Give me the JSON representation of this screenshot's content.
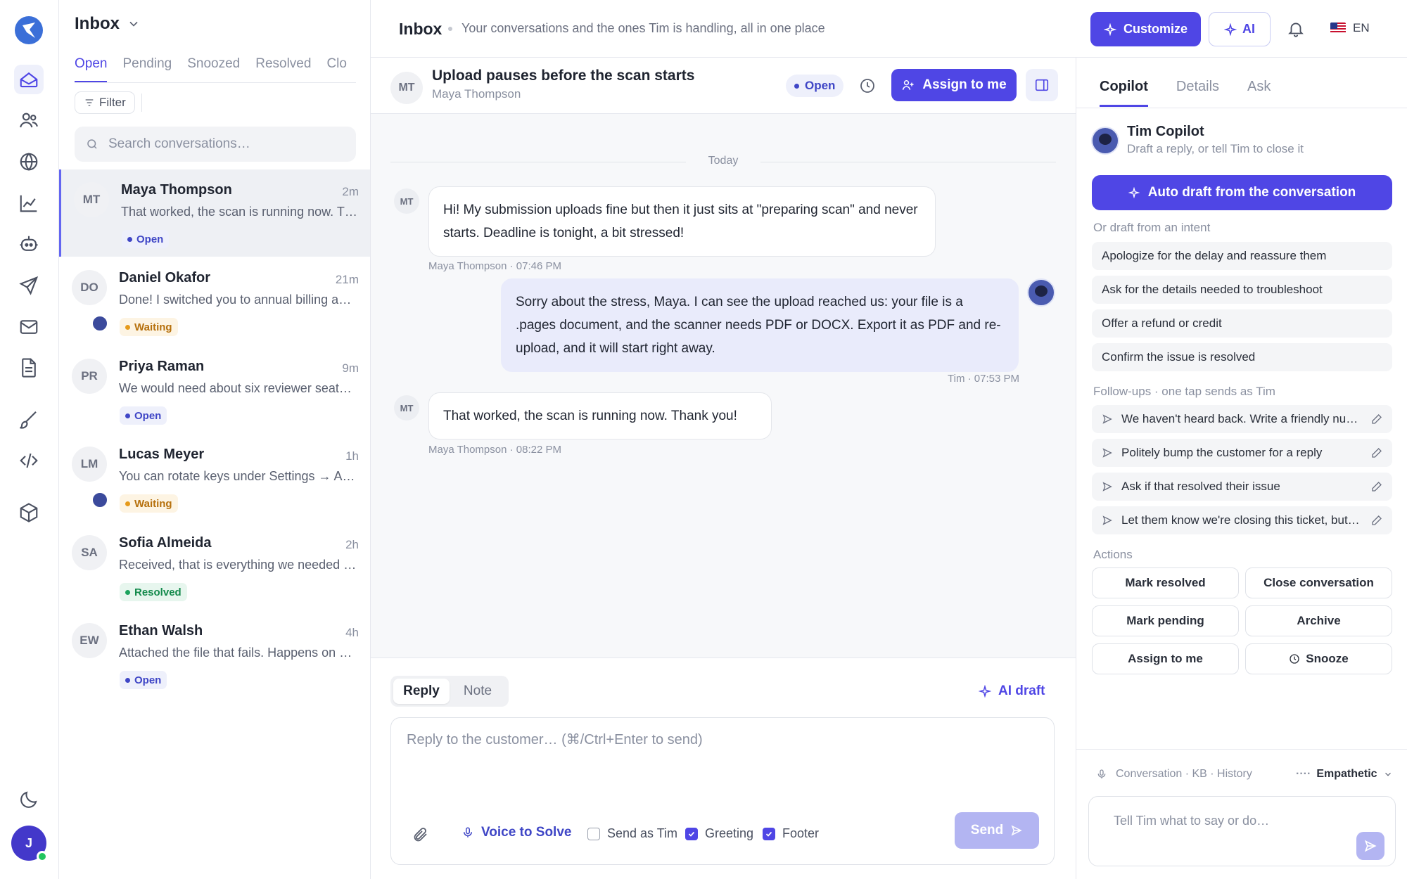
{
  "rail": {
    "items": [
      "inbox-icon",
      "contacts-icon",
      "globe-icon",
      "analytics-icon",
      "bot-icon",
      "send-icon",
      "mail-icon",
      "document-icon",
      "brush-icon",
      "code-icon",
      "box-icon"
    ],
    "user_initial": "J"
  },
  "list": {
    "title": "Inbox",
    "tabs": [
      "Open",
      "Pending",
      "Snoozed",
      "Resolved",
      "Clo"
    ],
    "filter_label": "Filter",
    "search_placeholder": "Search conversations…",
    "conversations": [
      {
        "initials": "MT",
        "name": "Maya Thompson",
        "time": "2m",
        "preview": "That worked, the scan is running now. Thank you!",
        "status": "Open"
      },
      {
        "initials": "DO",
        "name": "Daniel Okafor",
        "time": "21m",
        "preview": "Done! I switched you to annual billing and applied the discount.",
        "status": "Waiting"
      },
      {
        "initials": "PR",
        "name": "Priya Raman",
        "time": "9m",
        "preview": "We would need about six reviewer seats for the team.",
        "status": "Open"
      },
      {
        "initials": "LM",
        "name": "Lucas Meyer",
        "time": "1h",
        "preview": "You can rotate keys under Settings → API keys.",
        "status": "Waiting"
      },
      {
        "initials": "SA",
        "name": "Sofia Almeida",
        "time": "2h",
        "preview": "Received, that is everything we needed from you.",
        "status": "Resolved"
      },
      {
        "initials": "EW",
        "name": "Ethan Walsh",
        "time": "4h",
        "preview": "Attached the file that fails. Happens on every upload.",
        "status": "Open"
      }
    ]
  },
  "header": {
    "title": "Inbox",
    "subtitle": "Your conversations and the ones Tim is handling, all in one place",
    "customize_label": "Customize",
    "ai_label": "AI",
    "language": "EN"
  },
  "conversation": {
    "initials": "MT",
    "subject": "Upload pauses before the scan starts",
    "customer": "Maya Thompson",
    "status": "Open",
    "assign_label": "Assign to me",
    "day_divider": "Today",
    "messages": [
      {
        "from": "customer",
        "initials": "MT",
        "text": "Hi! My submission uploads fine but then it just sits at \"preparing scan\" and never starts. Deadline is tonight, a bit stressed!",
        "meta": "Maya Thompson · 07:46 PM"
      },
      {
        "from": "agent",
        "text": "Sorry about the stress, Maya. I can see the upload reached us: your file is a .pages document, and the scanner needs PDF or DOCX. Export it as PDF and re-upload, and it will start right away.",
        "meta": "Tim · 07:53 PM"
      },
      {
        "from": "customer",
        "initials": "MT",
        "text": "That worked, the scan is running now. Thank you!",
        "meta": "Maya Thompson · 08:22 PM"
      }
    ]
  },
  "composer": {
    "mode_reply": "Reply",
    "mode_note": "Note",
    "ai_draft_label": "AI draft",
    "placeholder": "Reply to the customer…  (⌘/Ctrl+Enter to send)",
    "voice_label": "Voice to Solve",
    "send_as_label": "Send as Tim",
    "greeting_label": "Greeting",
    "footer_label": "Footer",
    "send_as_checked": false,
    "greeting_checked": true,
    "footer_checked": true,
    "send_label": "Send"
  },
  "copilot": {
    "tabs": [
      "Copilot",
      "Details",
      "Ask"
    ],
    "name": "Tim Copilot",
    "subtitle": "Draft a reply, or tell Tim to close it",
    "auto_draft_label": "Auto draft from the conversation",
    "intent_heading": "Or draft from an intent",
    "intents": [
      "Apologize for the delay and reassure them",
      "Ask for the details needed to troubleshoot",
      "Offer a refund or credit",
      "Confirm the issue is resolved"
    ],
    "followups_heading": "Follow-ups · one tap sends as Tim",
    "followups": [
      "We haven't heard back. Write a friendly nudge",
      "Politely bump the customer for a reply",
      "Ask if that resolved their issue",
      "Let them know we're closing this ticket, but they can reply anytime"
    ],
    "actions_heading": "Actions",
    "actions": [
      "Mark resolved",
      "Close conversation",
      "Mark pending",
      "Archive",
      "Assign to me",
      "Snooze"
    ],
    "context": "Conversation · KB · History",
    "tone": "Empathetic",
    "ask_placeholder": "Tell Tim what to say or do…"
  },
  "colors": {
    "accent": "#4f46e5",
    "open": "#3f46c6",
    "waiting": "#b6700c",
    "resolved": "#148a4c"
  }
}
